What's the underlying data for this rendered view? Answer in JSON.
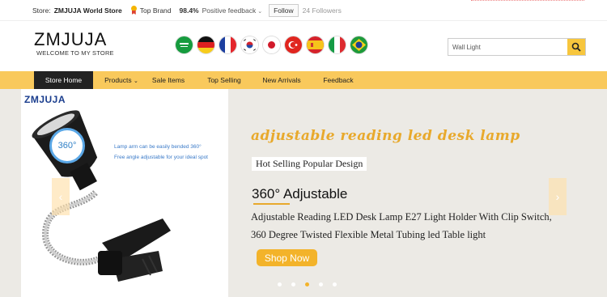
{
  "topbar": {
    "store_label": "Store:",
    "store_name": "ZMJUJA World Store",
    "top_brand": "Top Brand",
    "positive_pct": "98.4%",
    "positive_label": "Positive feedback",
    "follow_label": "Follow",
    "followers": "24 Followers"
  },
  "header": {
    "brand": "ZMJUJA",
    "tagline": "WELCOME TO MY STORE",
    "search_value": "Wall Light",
    "flags": [
      "saudi-arabia",
      "germany",
      "france",
      "south-korea",
      "japan",
      "turkey",
      "spain",
      "italy",
      "brazil"
    ]
  },
  "nav": {
    "items": [
      "Store Home",
      "Products",
      "Sale Items",
      "Top Selling",
      "New Arrivals",
      "Feedback"
    ]
  },
  "banner": {
    "product_brand": "ZMJUJA",
    "note_line1": "Lamp arm can be easily bended 360°",
    "note_line2": "Free angle adjustable for your ideal spot",
    "badge": "360°",
    "headline": "adjustable reading led desk lamp",
    "subtitle": "Hot Selling Popular Design",
    "deg_text": "360° Adjustable",
    "desc_line1": "Adjustable Reading LED Desk Lamp E27 Light Holder With Clip Switch,",
    "desc_line2": "360 Degree Twisted Flexible Metal Tubing led Table light",
    "cta": "Shop Now",
    "active_slide": 3
  },
  "colors": {
    "accent": "#f9c95c",
    "nav_active": "#222222",
    "cta": "#f3b32a",
    "headline": "#e8a92c",
    "brand_blue": "#1b3e8e"
  }
}
